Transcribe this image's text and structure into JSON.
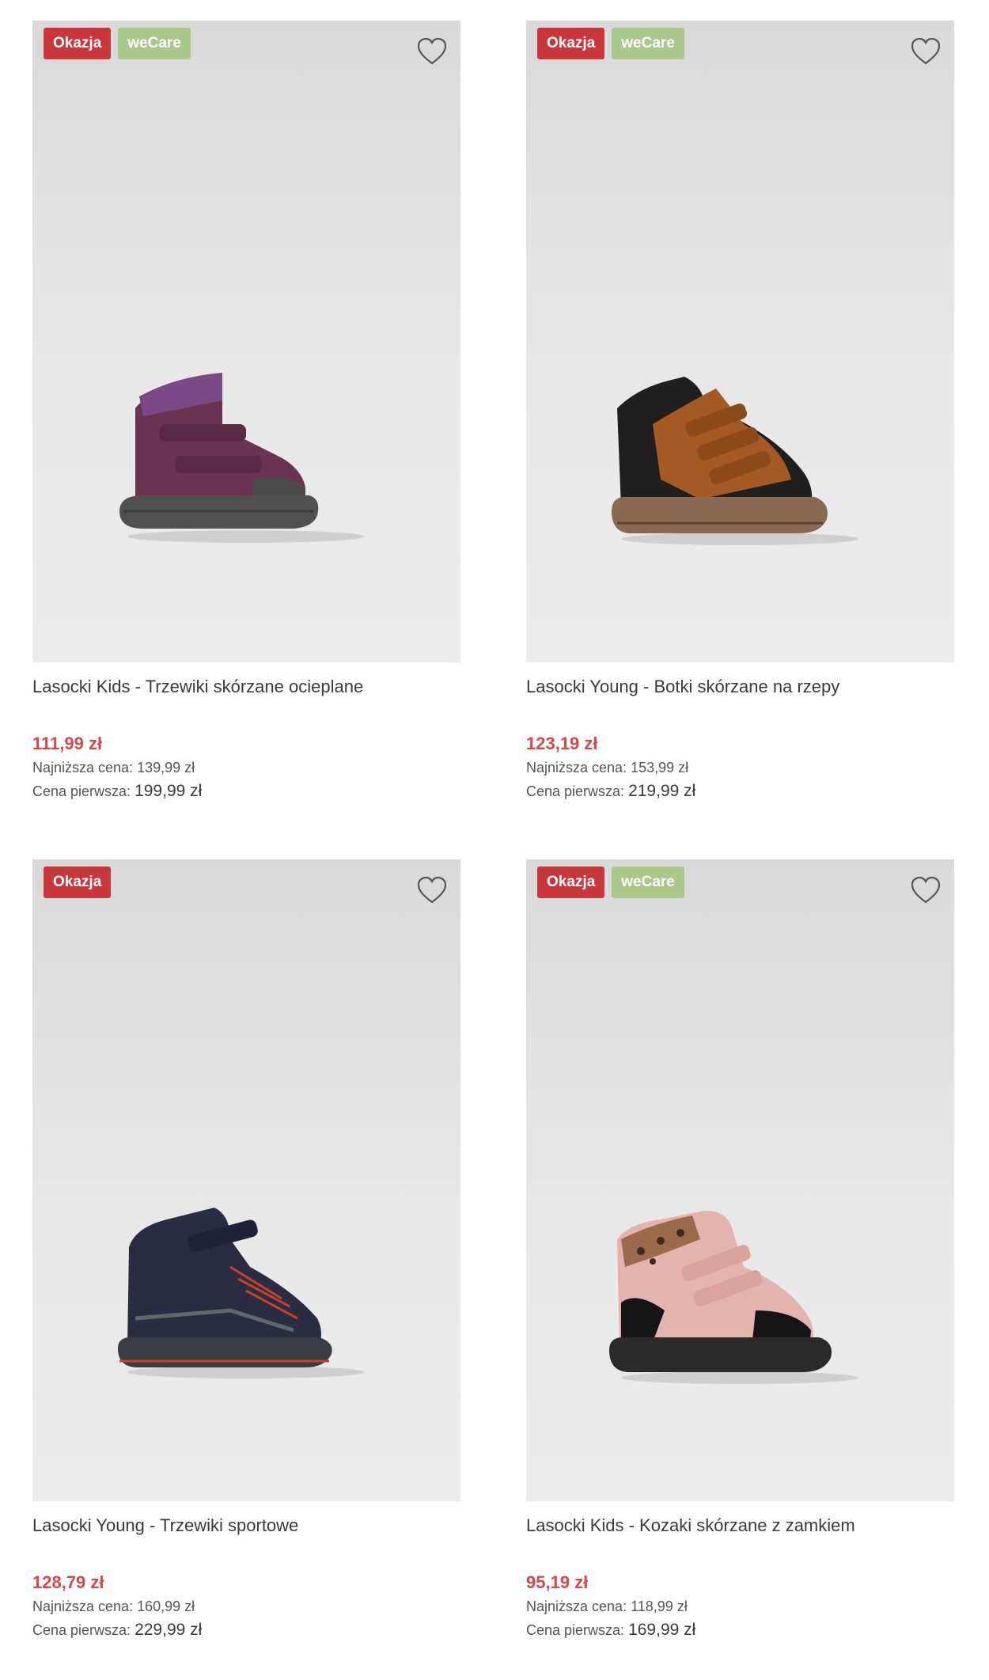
{
  "accent_color": "#c9373d",
  "wecare_color": "#a9c98b",
  "price_color": "#d7474c",
  "products": [
    {
      "badges": [
        "Okazja",
        "weCare"
      ],
      "wishlist_icon": "heart-outline-icon",
      "image": "purple-kids-boot",
      "title": "Lasocki Kids - Trzewiki skórzane ocieplane",
      "price": "111,99 zł",
      "lowest_label": "Najniższa cena:",
      "lowest_value": "139,99 zł",
      "original_label": "Cena pierwsza:",
      "original_value": "199,99 zł"
    },
    {
      "badges": [
        "Okazja",
        "weCare"
      ],
      "wishlist_icon": "heart-outline-icon",
      "image": "brown-velcro-boot",
      "title": "Lasocki Young - Botki skórzane na rzepy",
      "price": "123,19 zł",
      "lowest_label": "Najniższa cena:",
      "lowest_value": "153,99 zł",
      "original_label": "Cena pierwsza:",
      "original_value": "219,99 zł"
    },
    {
      "badges": [
        "Okazja"
      ],
      "wishlist_icon": "heart-outline-icon",
      "image": "navy-sport-boot",
      "title": "Lasocki Young - Trzewiki sportowe",
      "price": "128,79 zł",
      "lowest_label": "Najniższa cena:",
      "lowest_value": "160,99 zł",
      "original_label": "Cena pierwsza:",
      "original_value": "229,99 zł"
    },
    {
      "badges": [
        "Okazja",
        "weCare"
      ],
      "wishlist_icon": "heart-outline-icon",
      "image": "pink-leopard-boot",
      "title": "Lasocki Kids - Kozaki skórzane z zamkiem",
      "price": "95,19 zł",
      "lowest_label": "Najniższa cena:",
      "lowest_value": "118,99 zł",
      "original_label": "Cena pierwsza:",
      "original_value": "169,99 zł"
    }
  ]
}
